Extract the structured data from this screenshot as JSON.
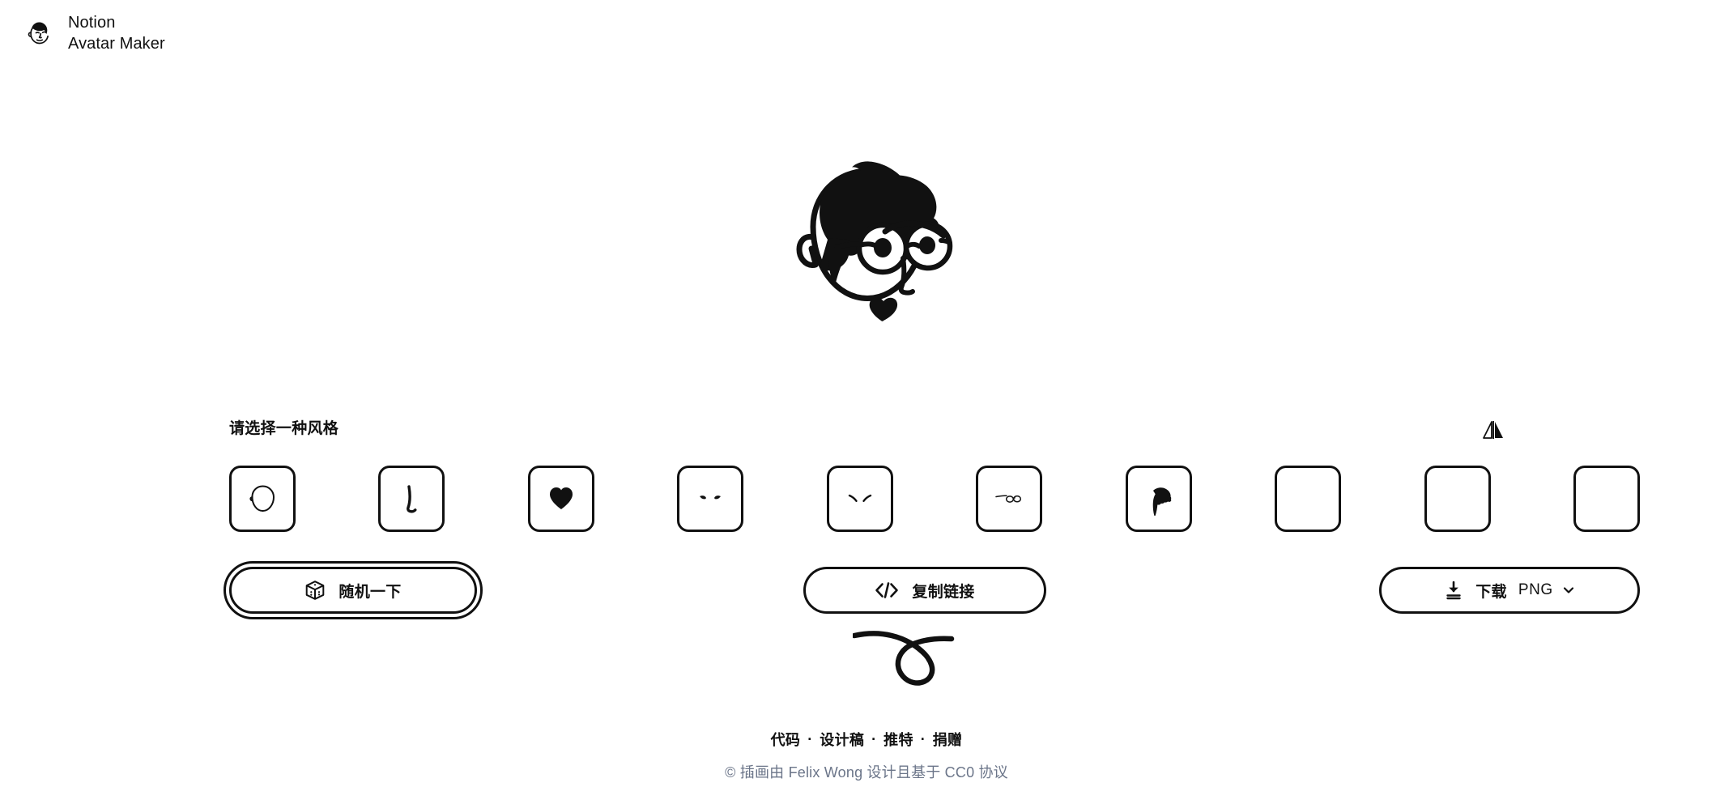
{
  "brand": {
    "logo_icon": "avatar-face-icon",
    "line1": "Notion",
    "line2": "Avatar Maker"
  },
  "preview": {
    "avatar_alt": "notion-style-avatar",
    "description": "Line-art face with tall wavy black hair, round glasses, and heart-shaped mouth"
  },
  "picker": {
    "label": "请选择一种风格",
    "flip_icon": "flip-horizontal-icon",
    "flip_tooltip": "",
    "items": [
      {
        "name": "face",
        "icon": "face-shape-icon",
        "selected": false
      },
      {
        "name": "nose",
        "icon": "nose-icon",
        "selected": false
      },
      {
        "name": "mouth",
        "icon": "heart-mouth-icon",
        "selected": false
      },
      {
        "name": "eyes",
        "icon": "eyes-icon",
        "selected": false
      },
      {
        "name": "eyebrows",
        "icon": "eyebrows-icon",
        "selected": false
      },
      {
        "name": "glasses",
        "icon": "glasses-icon",
        "selected": false
      },
      {
        "name": "hair",
        "icon": "hair-icon",
        "selected": false
      },
      {
        "name": "accessories",
        "icon": "empty-icon",
        "selected": false
      },
      {
        "name": "details",
        "icon": "empty-icon",
        "selected": false
      },
      {
        "name": "beard",
        "icon": "empty-icon",
        "selected": false
      }
    ]
  },
  "actions": {
    "random": {
      "label": "随机一下",
      "icon": "dice-icon",
      "focused": true
    },
    "copy": {
      "label": "复制链接",
      "icon": "code-brackets-icon"
    },
    "download": {
      "label": "下载",
      "icon": "download-icon",
      "format": "PNG",
      "chevron": "chevron-down-icon"
    }
  },
  "doodle": {
    "icon": "loop-squiggle-doodle"
  },
  "footer": {
    "links": [
      "代码",
      "设计稿",
      "推特",
      "捐赠"
    ],
    "separator": "·",
    "copyright_prefix": "©",
    "copyright_part1": "插画由",
    "copyright_author": "Felix Wong",
    "copyright_part2": "设计且基于",
    "copyright_license": "CC0",
    "copyright_part3": "协议",
    "copyright_full": "© 插画由 Felix Wong 设计且基于 CC0 协议"
  },
  "colors": {
    "ink": "#111111",
    "background": "#ffffff",
    "muted": "#6b7589"
  }
}
